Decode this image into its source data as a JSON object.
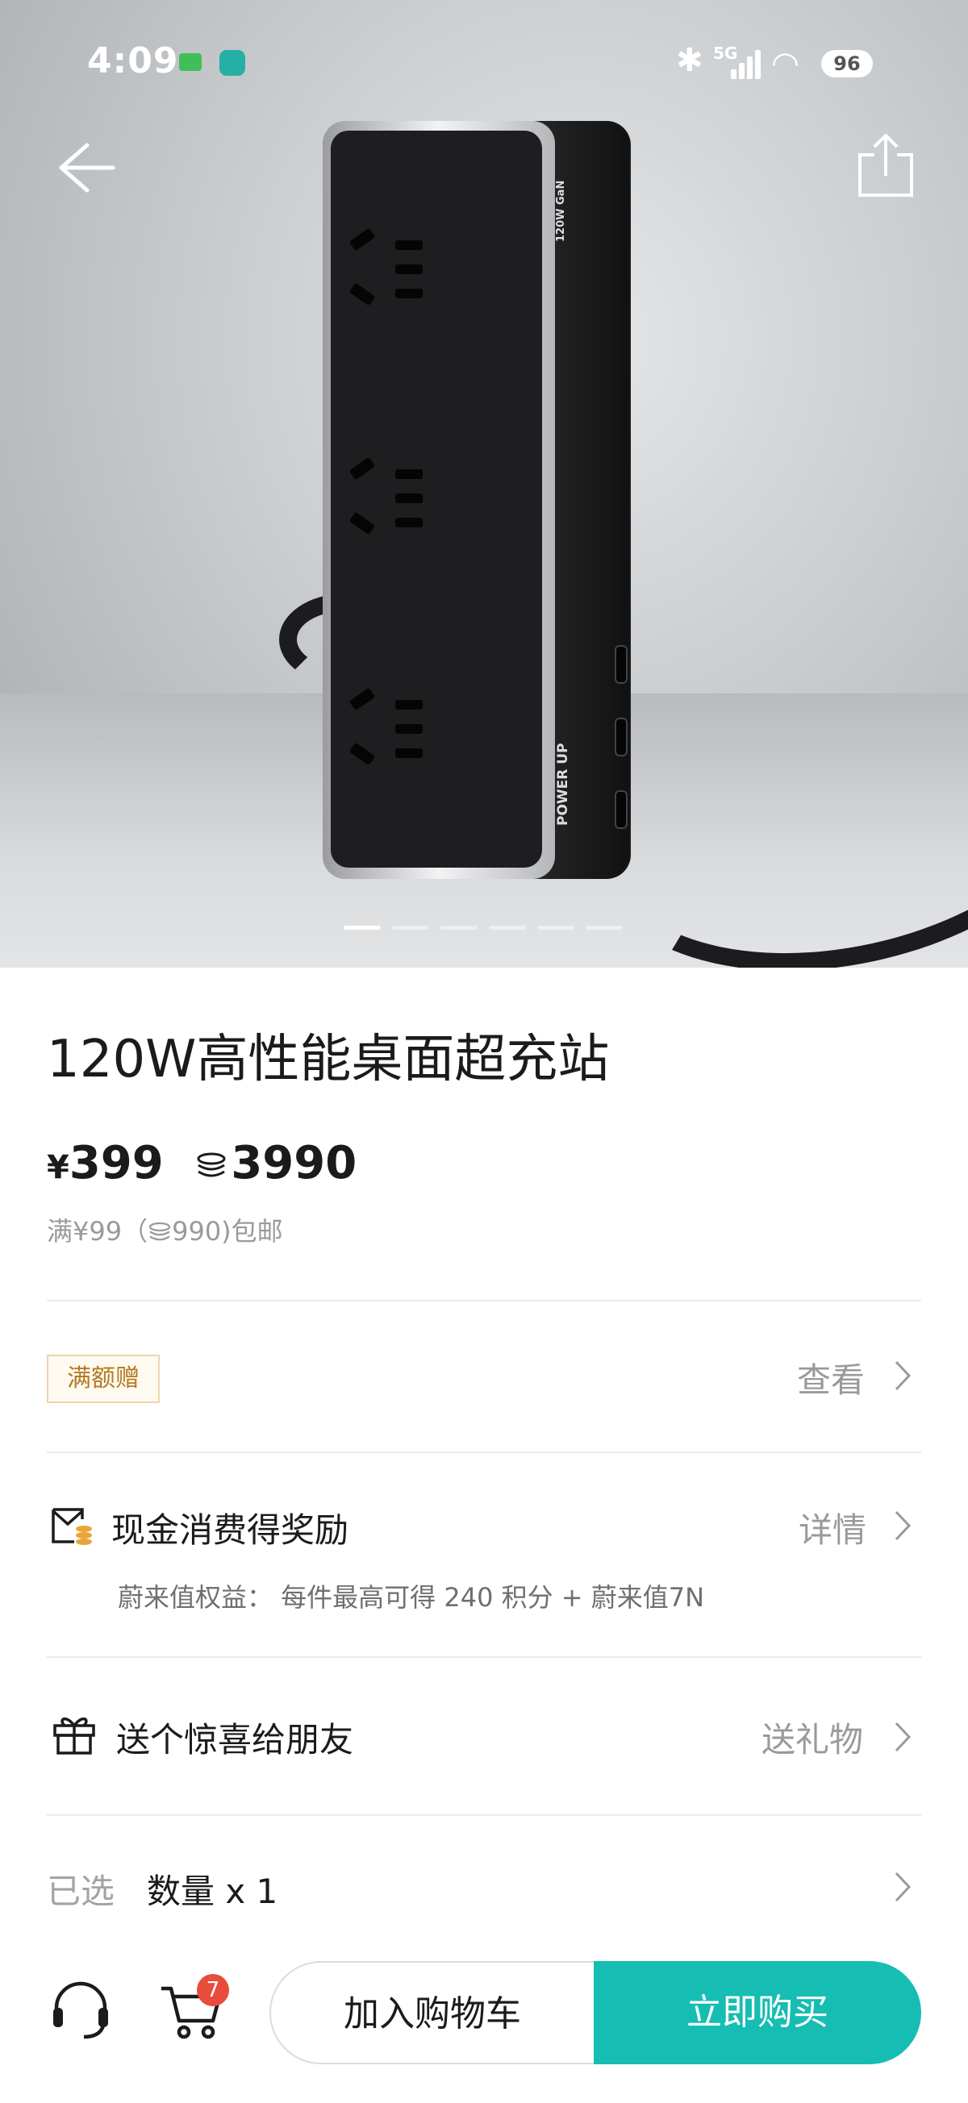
{
  "status_bar": {
    "time": "4:09",
    "network": "5G",
    "battery": "96"
  },
  "product": {
    "title": "120W高性能桌面超充站",
    "price_currency": "¥",
    "price": "399",
    "coin_price": "3990",
    "shipping_note": "满¥99（",
    "shipping_coin": "990)包邮",
    "strip_brand": "POWER UP",
    "strip_spec": "120W GaN",
    "carousel_count": 6,
    "carousel_active_index": 0
  },
  "promo": {
    "badge": "满额赠",
    "action": "查看"
  },
  "reward": {
    "title": "现金消费得奖励",
    "action": "详情",
    "subtitle": "蔚来值权益：  每件最高可得 240 积分 + 蔚来值7N"
  },
  "gift": {
    "title": "送个惊喜给朋友",
    "action": "送礼物"
  },
  "selection": {
    "label": "已选",
    "value": "数量 x 1"
  },
  "bottom_bar": {
    "cart_count": "7",
    "add_to_cart": "加入购物车",
    "buy_now": "立即购买",
    "buy_color": "#16bdb3"
  },
  "icons": [
    "back-arrow-icon",
    "share-icon",
    "coin-icon",
    "gift-box-icon",
    "wallet-coin-icon",
    "chevron-right-icon",
    "headset-icon",
    "cart-icon",
    "bluetooth-icon",
    "signal-icon",
    "wifi-icon",
    "battery-icon"
  ]
}
